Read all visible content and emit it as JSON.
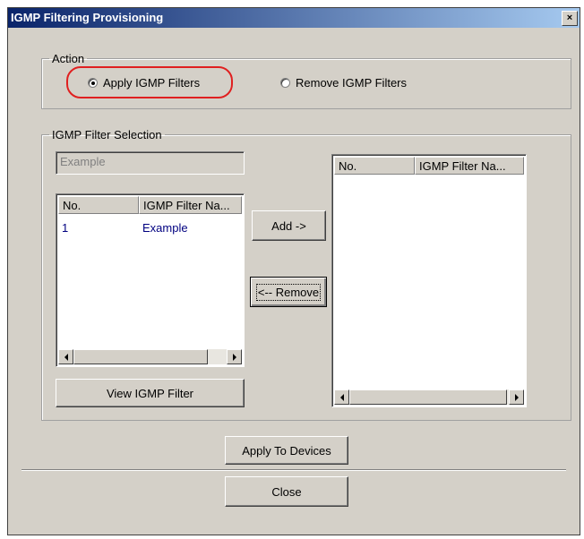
{
  "window": {
    "title": "IGMP Filtering Provisioning",
    "close_glyph": "×"
  },
  "action": {
    "legend": "Action",
    "options": [
      {
        "label": "Apply IGMP Filters",
        "selected": true
      },
      {
        "label": "Remove IGMP Filters",
        "selected": false
      }
    ]
  },
  "selection": {
    "legend": "IGMP Filter Selection",
    "name_field": {
      "value": "Example"
    },
    "available_table": {
      "columns": [
        "No.",
        "IGMP Filter Na..."
      ],
      "rows": [
        {
          "no": "1",
          "name": "Example"
        }
      ]
    },
    "selected_table": {
      "columns": [
        "No.",
        "IGMP Filter Na..."
      ],
      "rows": []
    },
    "add_label": "Add ->",
    "remove_label": "<-- Remove",
    "view_label": "View IGMP Filter"
  },
  "footer": {
    "apply_label": "Apply To Devices",
    "close_label": "Close"
  },
  "colors": {
    "titlebar": "#0a246a",
    "highlight": "#e02020",
    "row_text": "#000080"
  }
}
